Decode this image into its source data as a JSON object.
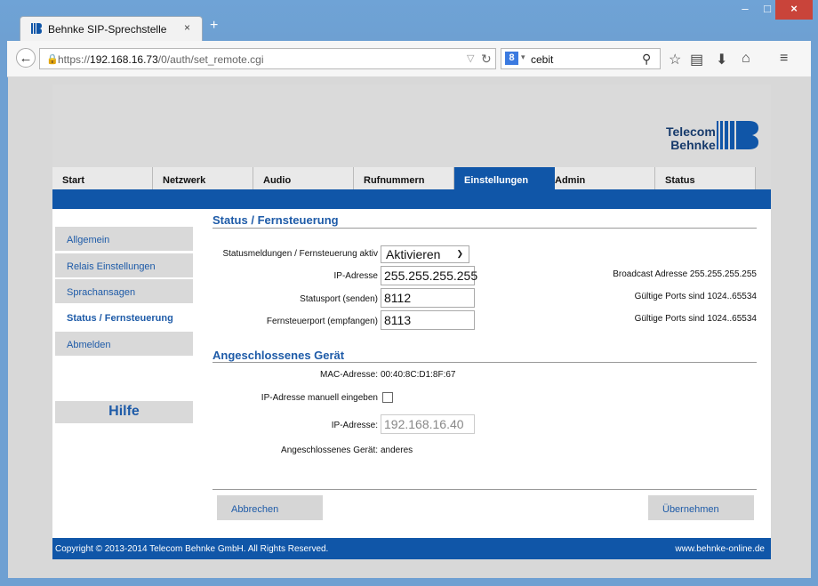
{
  "browser": {
    "tab_title": "Behnke SIP-Sprechstelle",
    "tab_close": "×",
    "new_tab": "+",
    "url_prefix": "https://",
    "url_host": "192.168.16.73",
    "url_path": "/0/auth/set_remote.cgi",
    "search_text": "cebit",
    "window_minimize": "–",
    "window_maximize": "□",
    "window_close": "×"
  },
  "logo": {
    "line1": "Telecom",
    "line2": "Behnke"
  },
  "nav": {
    "items": [
      {
        "label": "Start"
      },
      {
        "label": "Netzwerk"
      },
      {
        "label": "Audio"
      },
      {
        "label": "Rufnummern"
      },
      {
        "label": "Einstellungen"
      },
      {
        "label": "Admin"
      },
      {
        "label": "Status"
      }
    ],
    "active_index": 4
  },
  "sidebar": {
    "items": [
      {
        "label": "Allgemein"
      },
      {
        "label": "Relais Einstellungen"
      },
      {
        "label": "Sprachansagen"
      },
      {
        "label": "Status / Fernsteuerung"
      },
      {
        "label": "Abmelden"
      }
    ],
    "help": "Hilfe"
  },
  "section1": {
    "title": "Status / Fernsteuerung",
    "status_label": "Statusmeldungen / Fernsteuerung aktiv",
    "status_value": "Aktivieren",
    "ip_label": "IP-Adresse",
    "ip_value": "255.255.255.255",
    "ip_hint": "Broadcast Adresse 255.255.255.255",
    "statusport_label": "Statusport (senden)",
    "statusport_value": "8112",
    "statusport_hint": "Gültige Ports sind 1024..65534",
    "remoteport_label": "Fernsteuerport (empfangen)",
    "remoteport_value": "8113",
    "remoteport_hint": "Gültige Ports sind 1024..65534"
  },
  "section2": {
    "title": "Angeschlossenes Gerät",
    "mac_label": "MAC-Adresse:",
    "mac_value": "00:40:8C:D1:8F:67",
    "manual_label": "IP-Adresse manuell eingeben",
    "ip_label": "IP-Adresse:",
    "ip_value": "192.168.16.40",
    "device_label": "Angeschlossenes Gerät:",
    "device_value": "anderes"
  },
  "buttons": {
    "cancel": "Abbrechen",
    "apply": "Übernehmen"
  },
  "footer": {
    "copyright": "Copyright © 2013-2014 Telecom Behnke GmbH. All Rights Reserved.",
    "website": "www.behnke-online.de"
  },
  "colors": {
    "brand_blue": "#1056a8",
    "link_blue": "#1e5ba8",
    "close_red": "#c9443a"
  }
}
